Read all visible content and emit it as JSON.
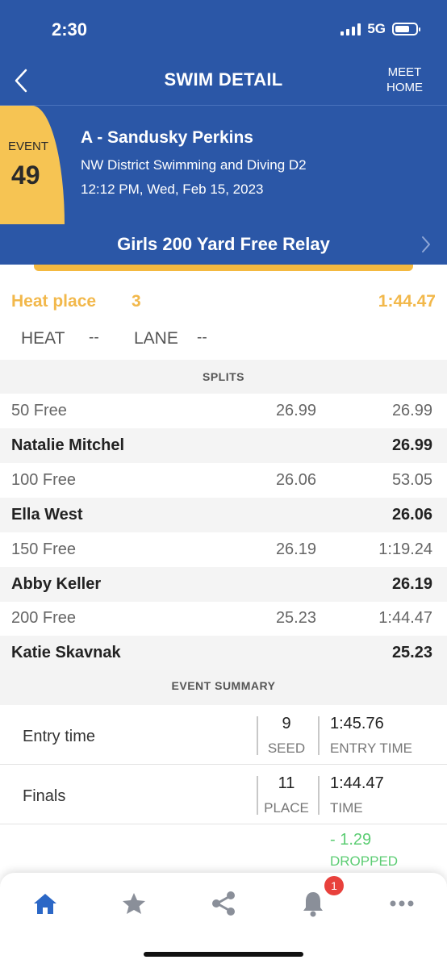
{
  "status": {
    "time": "2:30",
    "network": "5G"
  },
  "nav": {
    "title": "SWIM DETAIL",
    "meet_home": "MEET\nHOME"
  },
  "event": {
    "badge_label": "EVENT",
    "number": "49",
    "team": "A - Sandusky Perkins",
    "meet": "NW District Swimming and Diving D2",
    "datetime": "12:12 PM, Wed, Feb 15, 2023",
    "title": "Girls 200 Yard Free Relay"
  },
  "heat": {
    "place_label": "Heat place",
    "place_value": "3",
    "time": "1:44.47",
    "heat_label": "HEAT",
    "heat_value": "--",
    "lane_label": "LANE",
    "lane_value": "--"
  },
  "splits": {
    "header": "SPLITS",
    "rows": [
      {
        "distance": "50 Free",
        "split": "26.99",
        "cumulative": "26.99",
        "swimmer": "Natalie Mitchel",
        "swimmer_split": "26.99"
      },
      {
        "distance": "100 Free",
        "split": "26.06",
        "cumulative": "53.05",
        "swimmer": "Ella West",
        "swimmer_split": "26.06"
      },
      {
        "distance": "150 Free",
        "split": "26.19",
        "cumulative": "1:19.24",
        "swimmer": "Abby Keller",
        "swimmer_split": "26.19"
      },
      {
        "distance": "200 Free",
        "split": "25.23",
        "cumulative": "1:44.47",
        "swimmer": "Katie Skavnak",
        "swimmer_split": "25.23"
      }
    ]
  },
  "summary": {
    "header": "EVENT SUMMARY",
    "entry": {
      "label": "Entry time",
      "num": "9",
      "num_label": "SEED",
      "time": "1:45.76",
      "time_label": "ENTRY TIME"
    },
    "finals": {
      "label": "Finals",
      "num": "11",
      "num_label": "PLACE",
      "time": "1:44.47",
      "time_label": "TIME"
    },
    "dropped": {
      "value": "- 1.29",
      "label": "DROPPED"
    }
  },
  "tabbar": {
    "items": [
      "home-icon",
      "star-icon",
      "share-icon",
      "bell-icon",
      "more-icon"
    ],
    "notification_count": "1",
    "active_color": "#2b67c6",
    "inactive_color": "#8a8f99"
  },
  "colors": {
    "brand_blue": "#2b57a7",
    "gold": "#f2b84b",
    "green": "#5ccd73"
  }
}
